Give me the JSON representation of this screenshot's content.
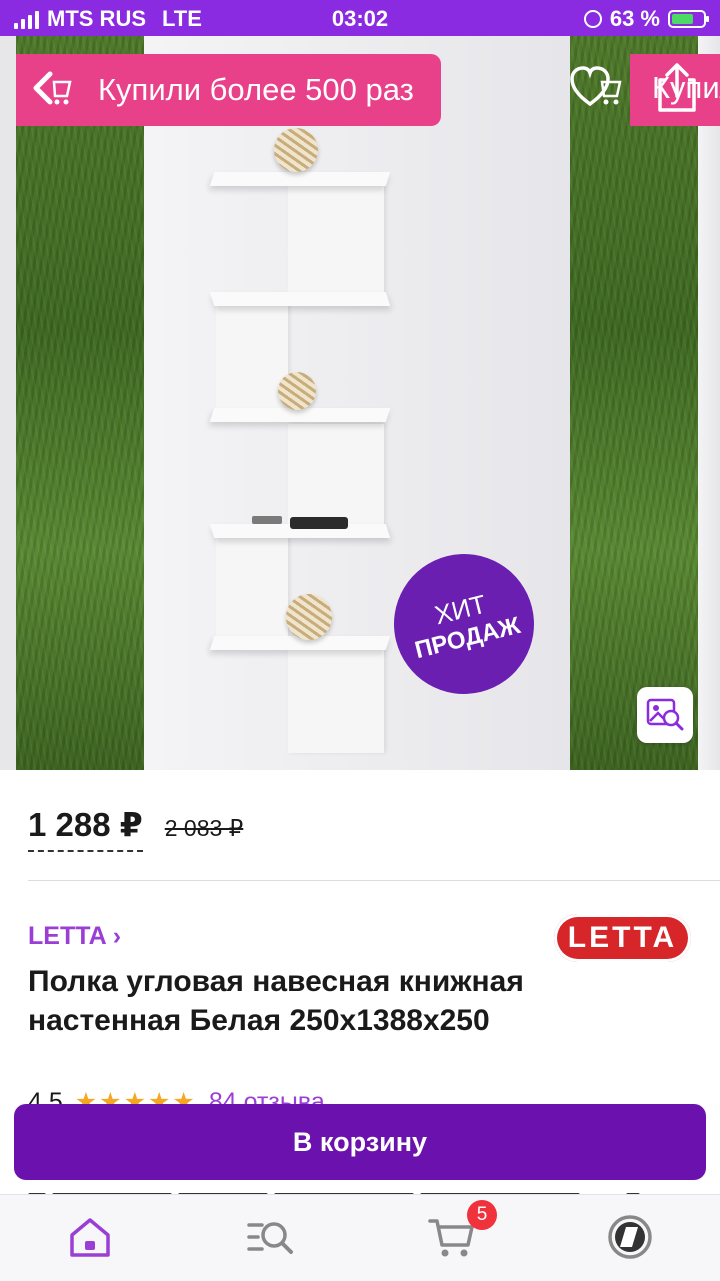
{
  "status_bar": {
    "carrier": "MTS RUS",
    "network": "LTE",
    "time": "03:02",
    "battery": "63 %"
  },
  "gallery": {
    "promo_banner": "Купили более 500 раз",
    "side_banner_text": "Купили",
    "badge_line1": "ХИТ",
    "badge_line2": "ПРОДАЖ",
    "icons": [
      "back-arrow-icon",
      "favorite-heart-icon",
      "share-icon",
      "image-search-icon"
    ]
  },
  "price": {
    "current": "1 288 ₽",
    "old": "2 083 ₽"
  },
  "product": {
    "brand": "LETTA ›",
    "brand_logo": "LETTA",
    "title": "Полка угловая навесная книжная настенная Белая 250x1388x250",
    "rating": "4,5",
    "stars": "★★★★★",
    "reviews": "84 отзыва"
  },
  "actions": {
    "add_to_cart": "В корзину"
  },
  "tabbar": {
    "items": [
      "home-icon",
      "catalog-search-icon",
      "cart-icon",
      "profile-icon"
    ],
    "cart_count": "5"
  },
  "colors": {
    "brand_purple": "#6b12ae",
    "status_purple": "#8a2be2",
    "promo_pink": "#e8418a",
    "link_purple": "#9a3ed6"
  }
}
